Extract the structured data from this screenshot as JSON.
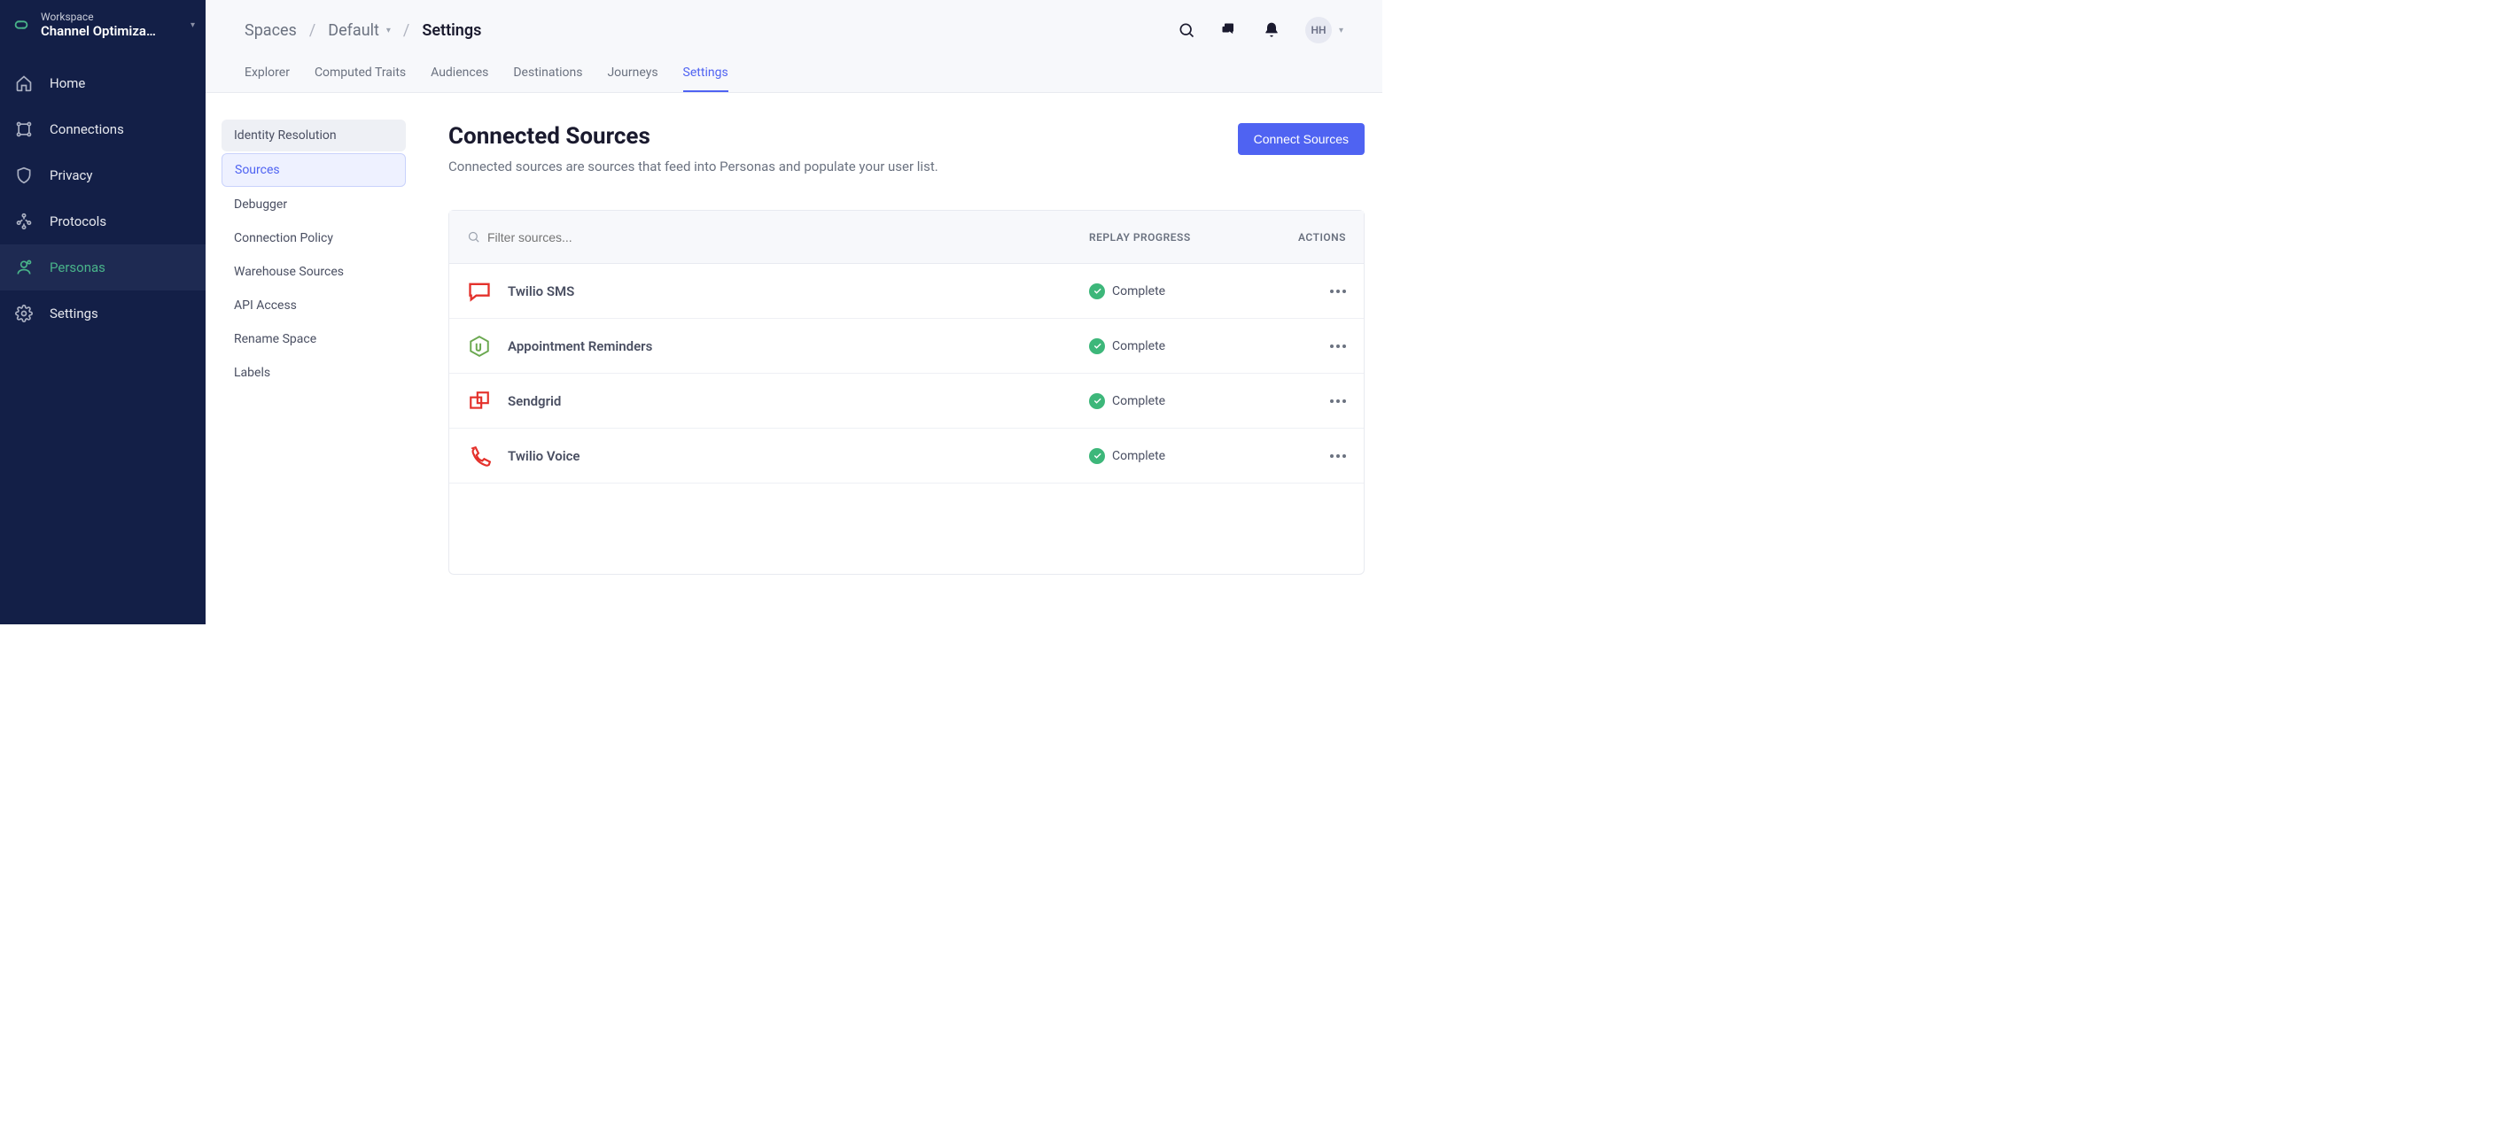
{
  "workspace": {
    "label": "Workspace",
    "name": "Channel Optimiza…"
  },
  "nav": {
    "items": [
      {
        "label": "Home"
      },
      {
        "label": "Connections"
      },
      {
        "label": "Privacy"
      },
      {
        "label": "Protocols"
      },
      {
        "label": "Personas"
      },
      {
        "label": "Settings"
      }
    ]
  },
  "breadcrumb": {
    "spaces": "Spaces",
    "default": "Default",
    "current": "Settings"
  },
  "avatar": "HH",
  "tabs": [
    {
      "label": "Explorer"
    },
    {
      "label": "Computed Traits"
    },
    {
      "label": "Audiences"
    },
    {
      "label": "Destinations"
    },
    {
      "label": "Journeys"
    },
    {
      "label": "Settings"
    }
  ],
  "submenu": [
    {
      "label": "Identity Resolution"
    },
    {
      "label": "Sources"
    },
    {
      "label": "Debugger"
    },
    {
      "label": "Connection Policy"
    },
    {
      "label": "Warehouse Sources"
    },
    {
      "label": "API Access"
    },
    {
      "label": "Rename Space"
    },
    {
      "label": "Labels"
    }
  ],
  "page": {
    "title": "Connected Sources",
    "subtitle": "Connected sources are sources that feed into Personas and populate your user list.",
    "connect_button": "Connect Sources",
    "filter_placeholder": "Filter sources...",
    "th_replay": "REPLAY PROGRESS",
    "th_actions": "ACTIONS"
  },
  "rows": [
    {
      "name": "Twilio SMS",
      "status": "Complete"
    },
    {
      "name": "Appointment Reminders",
      "status": "Complete"
    },
    {
      "name": "Sendgrid",
      "status": "Complete"
    },
    {
      "name": "Twilio Voice",
      "status": "Complete"
    }
  ]
}
